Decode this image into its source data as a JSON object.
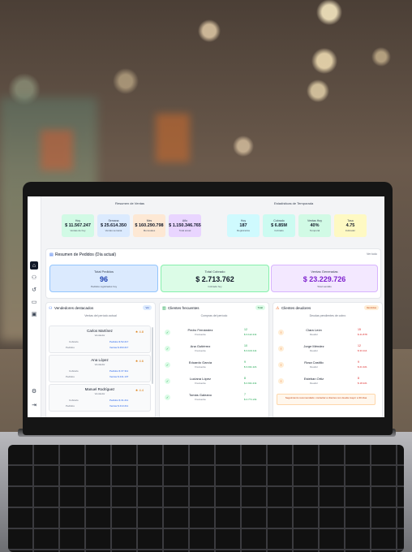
{
  "colors": {
    "ventas_bg": "#d1fae5",
    "semana_bg": "#dbeafe",
    "mes_bg": "#fde8d4",
    "ano_bg": "#e9d5ff",
    "total_bg": "#dbeafe",
    "total_border": "#93c5fd",
    "total_value": "#1e40af",
    "cobrado_bg": "#dcfce7",
    "cobrado_border": "#86efac",
    "vendido_bg": "#f3e8ff",
    "vendido_border": "#d8b4fe",
    "vendido_value": "#7e22ce",
    "green": "#16a34a",
    "orange": "#ea580c",
    "red": "#dc2626"
  },
  "sidebar": {
    "icons": [
      "home-icon",
      "users-icon",
      "history-icon",
      "clipboard-icon",
      "box-icon",
      "settings-icon",
      "logout-icon"
    ]
  },
  "summary": {
    "ventas_title": "Resumen de Ventas",
    "temporada_title": "Estadísticas de Temporada",
    "ventas_cards": [
      {
        "label": "Hoy",
        "value": "$ 11.567.247",
        "sub": "Ventas de hoy"
      },
      {
        "label": "Semana",
        "value": "$ 25.614.350",
        "sub": "Ventas semana"
      },
      {
        "label": "Mes",
        "value": "$ 160.290.798",
        "sub": "Mensuales"
      },
      {
        "label": "Año",
        "value": "$ 1.150.346.765",
        "sub": "Total anual"
      }
    ],
    "temporada_cards": [
      {
        "label": "Hoy",
        "value": "187",
        "sub": "Registrados"
      },
      {
        "label": "Cobrado",
        "value": "$ 6.85M",
        "sub": "Cobrado"
      },
      {
        "label": "Ventas Hoy",
        "value": "40%",
        "sub": "Temporal"
      },
      {
        "label": "Tasa",
        "value": "4.75",
        "sub": "Indicador"
      }
    ]
  },
  "resumen": {
    "title": "Resumen de Pedidos (Día actual)",
    "link": "Ver todo",
    "cards": [
      {
        "label": "Total Pedidos",
        "value": "96",
        "sub": "Pedidos registrados hoy"
      },
      {
        "label": "Total Cobrado",
        "value": "$ 2.713.762",
        "sub": "Cobrado hoy"
      },
      {
        "label": "Ventas Generadas",
        "value": "$ 23.229.726",
        "sub": "Total vendido"
      }
    ]
  },
  "vendedores": {
    "title": "Vendedores destacados",
    "badge": "Ver",
    "subtitle": "Ventas del período actual",
    "items": [
      {
        "name": "Carlos Martínez",
        "role": "Vendedor",
        "rating": "4.8",
        "k1": "Cobrado",
        "v1": "Pedidos $ 52.217",
        "k2": "Pedidos",
        "v2": "Ventas $ 263.217"
      },
      {
        "name": "Ana López",
        "role": "Vendedor",
        "rating": "4.6",
        "k1": "Cobrado",
        "v1": "Pedidos $ 37.311",
        "k2": "Pedidos",
        "v2": "Ventas $ 241.137"
      },
      {
        "name": "Manuel Rodríguez",
        "role": "Vendedor",
        "rating": "4.4",
        "k1": "Cobrado",
        "v1": "Pedidos $ 31.211",
        "k2": "Pedidos",
        "v2": "Ventas $ 213.211"
      }
    ]
  },
  "frecuentes": {
    "title": "Clientes frecuentes",
    "badge": "Total",
    "subtitle": "Compras del período",
    "items": [
      {
        "name": "Pedro Fernández",
        "role": "Frecuente",
        "count": "12",
        "amount": "$ 3.112.211"
      },
      {
        "name": "Ana Gutiérrez",
        "role": "Frecuente",
        "count": "10",
        "amount": "$ 3.104.111"
      },
      {
        "name": "Eduardo García",
        "role": "Frecuente",
        "count": "9",
        "amount": "$ 3.011.121"
      },
      {
        "name": "Luciana López",
        "role": "Frecuente",
        "count": "8",
        "amount": "$ 2.911.211"
      },
      {
        "name": "Tomás Galeano",
        "role": "Frecuente",
        "count": "7",
        "amount": "$ 2.771.211"
      }
    ]
  },
  "deudores": {
    "title": "Clientes deudores",
    "badge": "Vencidos",
    "subtitle": "Deudas pendientes de cobro",
    "items": [
      {
        "name": "Clara León",
        "role": "Deudor",
        "count": "15",
        "amount": "$ 41.878"
      },
      {
        "name": "Jorge Méndez",
        "role": "Deudor",
        "count": "12",
        "amount": "$ 33.114"
      },
      {
        "name": "Rosa Castillo",
        "role": "Deudor",
        "count": "9",
        "amount": "$ 21.321"
      },
      {
        "name": "Esteban Ortiz",
        "role": "Deudor",
        "count": "8",
        "amount": "$ 18.221"
      }
    ],
    "alert": "Seguimiento recomendado: contactar a clientes con deuda mayor a 30 días"
  }
}
